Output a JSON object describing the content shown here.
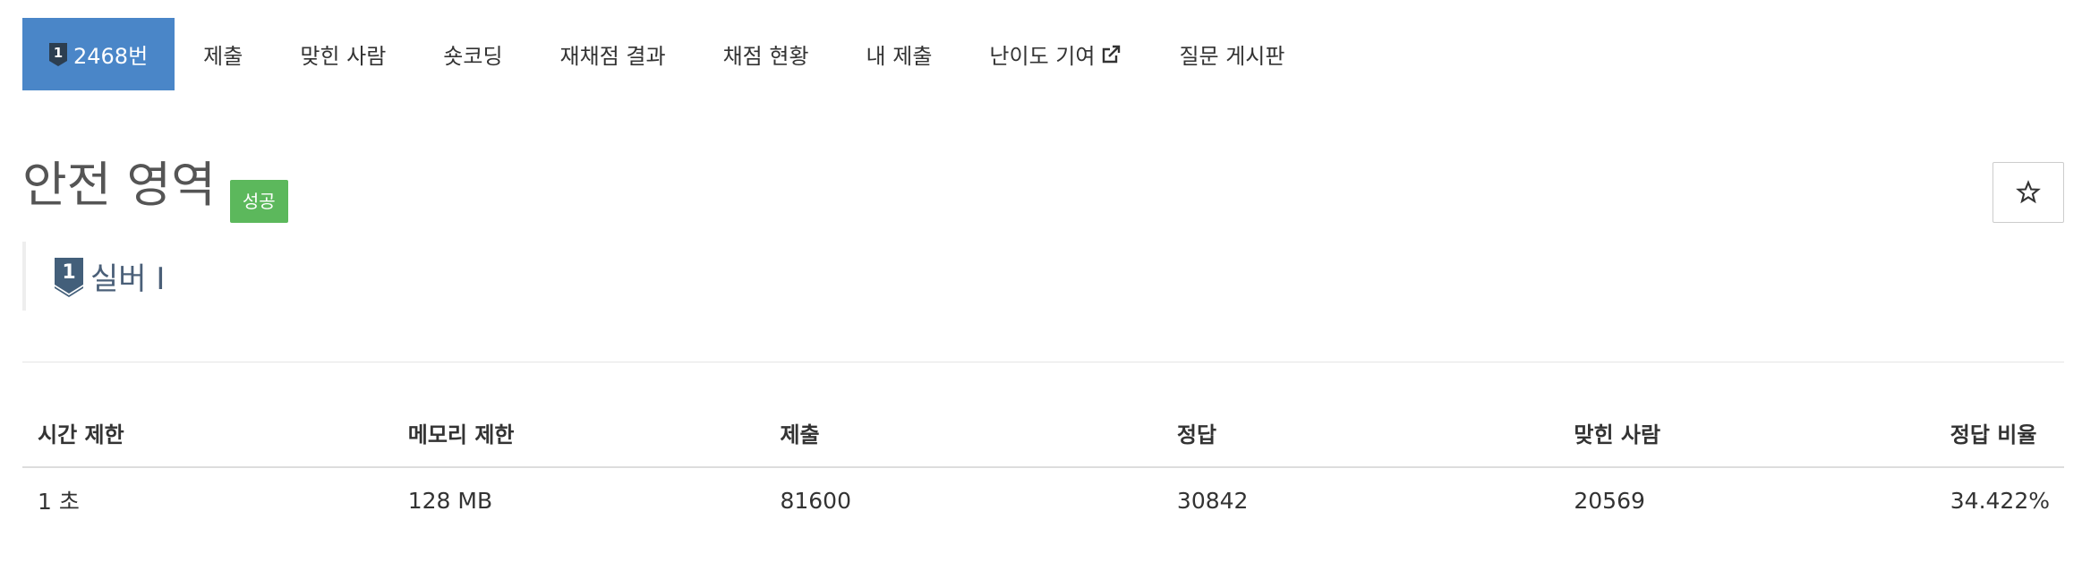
{
  "tabs": [
    {
      "label": "2468번",
      "active": true,
      "icon": "silver-tier-1-icon"
    },
    {
      "label": "제출"
    },
    {
      "label": "맞힌 사람"
    },
    {
      "label": "숏코딩"
    },
    {
      "label": "재채점 결과"
    },
    {
      "label": "채점 현황"
    },
    {
      "label": "내 제출"
    },
    {
      "label": "난이도 기여",
      "icon": "external-link-icon"
    },
    {
      "label": "질문 게시판"
    }
  ],
  "problem": {
    "title": "안전 영역",
    "badge": "성공",
    "star_icon": "star-outline-icon",
    "tier": {
      "label": "실버 I",
      "icon_digit": "1",
      "icon": "silver-tier-1-icon"
    }
  },
  "info_table": {
    "headers": [
      "시간 제한",
      "메모리 제한",
      "제출",
      "정답",
      "맞힌 사람",
      "정답 비율"
    ],
    "row": [
      "1 초",
      "128 MB",
      "81600",
      "30842",
      "20569",
      "34.422%"
    ]
  },
  "colors": {
    "active_tab": "#4a86c8",
    "badge_success": "#5cb85c",
    "tier_silver": "#435f7a",
    "text": "#333333"
  }
}
